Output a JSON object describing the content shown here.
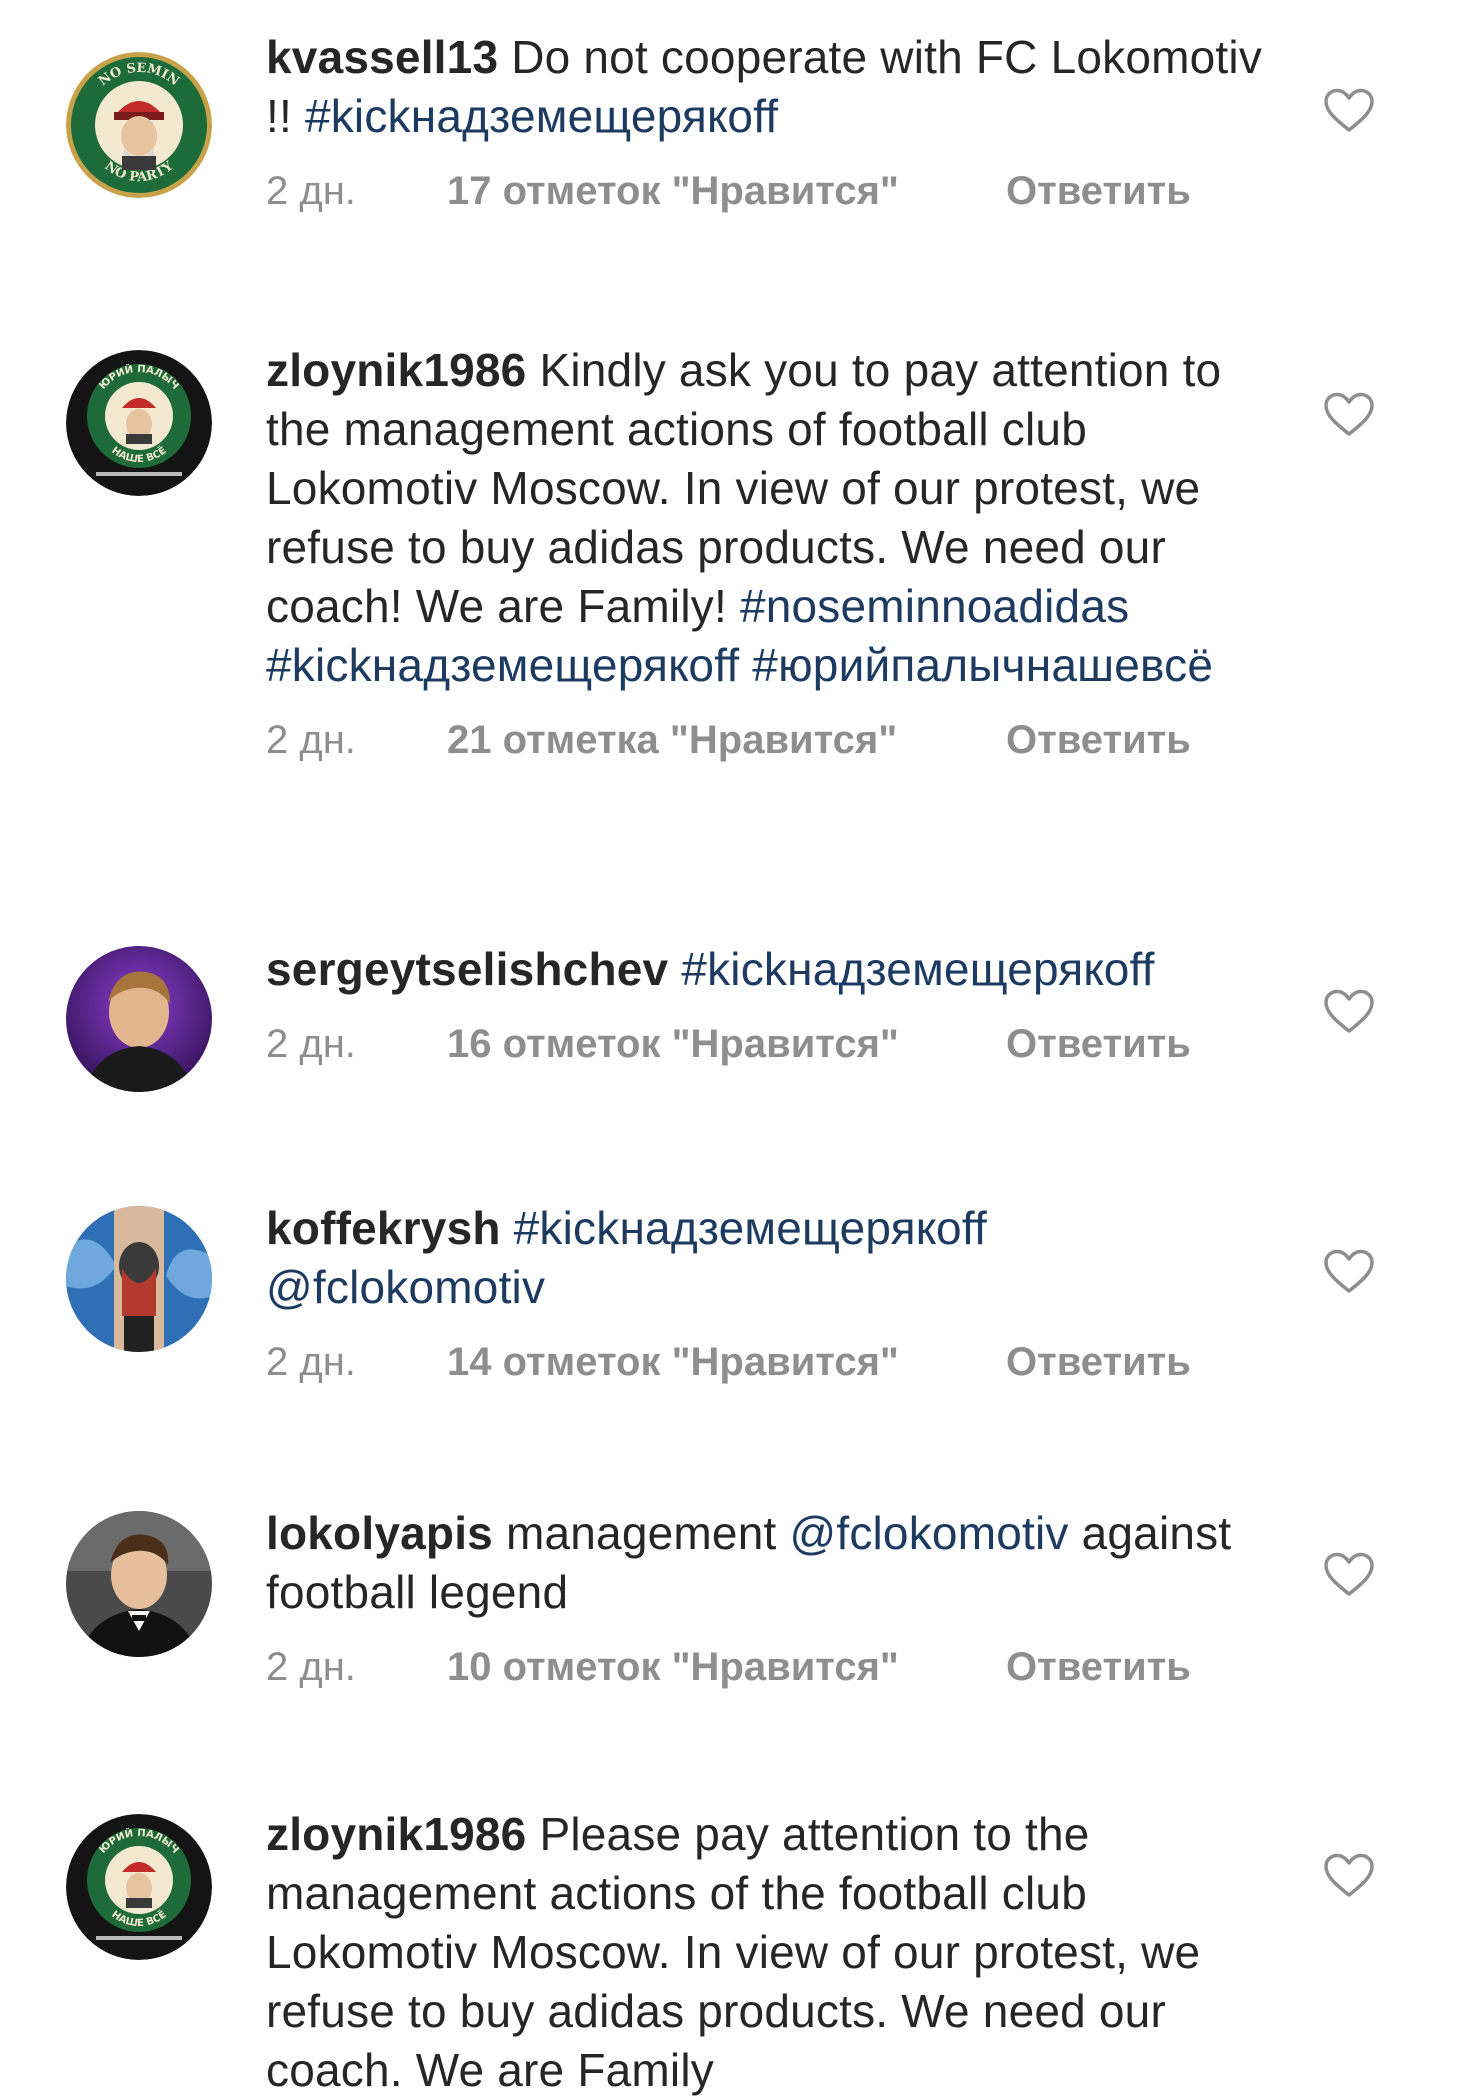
{
  "comments": [
    {
      "username": "kvassell13",
      "segments": [
        {
          "text": "Do not cooperate with FC Lokomotiv !! ",
          "type": "text"
        },
        {
          "text": "#kickнадземещерякoff",
          "type": "tag"
        }
      ],
      "time": "2 дн.",
      "likes": "17 отметок \"Нравится\"",
      "reply": "Ответить",
      "avatar": "avatar-no-semin-no-party",
      "avatar_text_top": "NO SEMIN",
      "avatar_text_bottom": "NO PARTY"
    },
    {
      "username": "zloynik1986",
      "segments": [
        {
          "text": "Kindly ask you to pay attention to the management actions of football club Lokomotiv Moscow. In view of our protest, we refuse to buy adidas products. We need our coach! We are Family! ",
          "type": "text"
        },
        {
          "text": "#noseminnoadidas #kickнадземещерякoff #юрийпалычнашевсё",
          "type": "tag"
        }
      ],
      "time": "2 дн.",
      "likes": "21 отметка \"Нравится\"",
      "reply": "Ответить",
      "avatar": "avatar-yuri-palych",
      "avatar_text_top": "ЮРИЙ ПАЛЫЧ",
      "avatar_text_bottom": "НАШЕ ВСЁ"
    },
    {
      "username": "sergeytselishchev",
      "segments": [
        {
          "text": "#kickнадземещерякoff",
          "type": "tag"
        }
      ],
      "time": "2 дн.",
      "likes": "16 отметок \"Нравится\"",
      "reply": "Ответить",
      "avatar": "avatar-photo-purple"
    },
    {
      "username": "koffekrysh",
      "segments": [
        {
          "text": "#kickнадземещерякoff @fclokomotiv",
          "type": "tag"
        }
      ],
      "time": "2 дн.",
      "likes": "14 отметок \"Нравится\"",
      "reply": "Ответить",
      "avatar": "avatar-tattoo"
    },
    {
      "username": "lokolyapis",
      "segments": [
        {
          "text": "management ",
          "type": "text"
        },
        {
          "text": "@fclokomotiv",
          "type": "tag"
        },
        {
          "text": " against football legend",
          "type": "text"
        }
      ],
      "time": "2 дн.",
      "likes": "10 отметок \"Нравится\"",
      "reply": "Ответить",
      "avatar": "avatar-photo-suit"
    },
    {
      "username": "zloynik1986",
      "segments": [
        {
          "text": "Please pay attention to the management actions of the football club Lokomotiv Moscow. In view of our protest, we refuse to buy adidas products. We need our coach. We are Family",
          "type": "text"
        }
      ],
      "avatar": "avatar-yuri-palych",
      "avatar_text_top": "ЮРИЙ ПАЛЫЧ",
      "avatar_text_bottom": "НАШЕ ВСЁ"
    }
  ],
  "colors": {
    "username": "#262626",
    "text": "#262626",
    "hashtag": "#1d3b60",
    "meta": "#8e8e8e",
    "heart_stroke": "#8e8e8e"
  }
}
